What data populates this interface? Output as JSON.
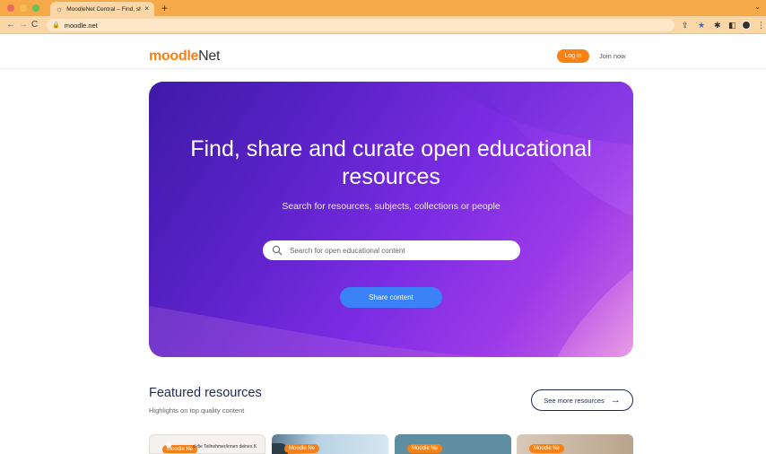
{
  "browser": {
    "tab_title": "MoodleNet Central – Find, shar",
    "tab_close": "×",
    "new_tab": "+",
    "url": "moodle.net",
    "nav_back": "←",
    "nav_forward": "→",
    "nav_reload": "C"
  },
  "header": {
    "logo_moodle": "moodle",
    "logo_net": "Net",
    "login_label": "Log in",
    "join_label": "Join now"
  },
  "hero": {
    "title": "Find, share and curate open educational resources",
    "subtitle": "Search for resources, subjects, collections or people",
    "search_placeholder": "Search for open educational content",
    "share_label": "Share content"
  },
  "featured": {
    "title": "Featured resources",
    "subtitle": "Highlights on top quality content",
    "see_more_label": "See more resources",
    "see_more_arrow": "→",
    "cards": [
      {
        "badge": "Moodle Ne",
        "text": "d die Teilnehmer/innen deines K"
      },
      {
        "badge": "Moodle Ne"
      },
      {
        "badge": "Moodle Ne"
      },
      {
        "badge": "Moodle Ne"
      }
    ]
  },
  "colors": {
    "brand_orange": "#f98012",
    "chrome_orange": "#f6a948",
    "hero_start": "#3e1aa8",
    "hero_end": "#c766e3",
    "share_blue": "#3b82f6",
    "navy": "#1e2a4f"
  }
}
